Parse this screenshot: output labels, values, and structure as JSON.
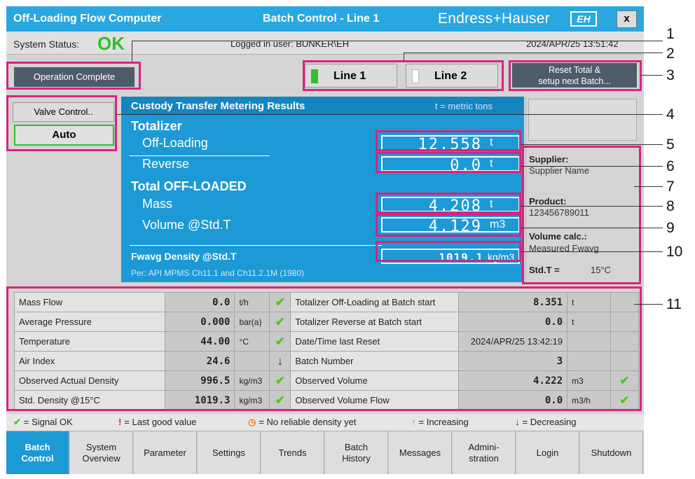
{
  "titlebar": {
    "app": "Off-Loading Flow Computer",
    "screen": "Batch Control - Line 1",
    "brand": "Endress+Hauser",
    "logo": "EH",
    "close": "x"
  },
  "status": {
    "label": "System Status:",
    "value": "OK",
    "user": "Logged in user: BUNKER\\EH",
    "datetime": "2024/APR/25  13:51:42"
  },
  "controls": {
    "operation": "Operation Complete",
    "line1": "Line 1",
    "line2": "Line 2",
    "reset_line1": "Reset Total &",
    "reset_line2": "setup next Batch...",
    "valve": "Valve Control..",
    "auto": "Auto"
  },
  "results": {
    "header": "Custody Transfer Metering Results",
    "unit_note": "t = metric tons",
    "totalizer": "Totalizer",
    "offloading": "Off-Loading",
    "offloading_val": "12.558",
    "offloading_unit": "t",
    "reverse": "Reverse",
    "reverse_val": "0.0",
    "reverse_unit": "t",
    "total": "Total OFF-LOADED",
    "mass": "Mass",
    "mass_val": "4.208",
    "mass_unit": "t",
    "volume": "Volume @Std.T",
    "volume_val": "4.129",
    "volume_unit": "m3",
    "density": "Fwavg Density @Std.T",
    "density_val": "1019.1",
    "density_unit": "kg/m3",
    "per": "Per: API MPMS Ch11.1 and Ch11.2.1M (1980)"
  },
  "side": {
    "supplier_k": "Supplier:",
    "supplier_v": "Supplier Name",
    "product_k": "Product:",
    "product_v": "123456789011",
    "volcalc_k": "Volume calc.:",
    "volcalc_v": "Measured Fwavg",
    "stdt_k": "Std.T =",
    "stdt_v": "15°C"
  },
  "grid": [
    {
      "label": "Mass Flow",
      "value": "0.0",
      "unit": "t/h",
      "icon": "check",
      "label2": "Totalizer Off-Loading at Batch start",
      "value2": "8.351",
      "unit2": "t",
      "icon2": ""
    },
    {
      "label": "Average Pressure",
      "value": "0.000",
      "unit": "bar(a)",
      "icon": "check",
      "label2": "Totalizer Reverse at Batch start",
      "value2": "0.0",
      "unit2": "t",
      "icon2": ""
    },
    {
      "label": "Temperature",
      "value": "44.00",
      "unit": "°C",
      "icon": "check",
      "label2": "Date/Time last Reset",
      "value2": "2024/APR/25 13:42:19",
      "unit2": "",
      "icon2": ""
    },
    {
      "label": "Air Index",
      "value": "24.6",
      "unit": "",
      "icon": "decreasing",
      "label2": "Batch Number",
      "value2": "3",
      "unit2": "",
      "icon2": ""
    },
    {
      "label": "Observed Actual Density",
      "value": "996.5",
      "unit": "kg/m3",
      "icon": "check",
      "label2": "Observed Volume",
      "value2": "4.222",
      "unit2": "m3",
      "icon2": "check"
    },
    {
      "label": "Std. Density @15°C",
      "value": "1019.3",
      "unit": "kg/m3",
      "icon": "check",
      "label2": "Observed Volume Flow",
      "value2": "0.0",
      "unit2": "m3/h",
      "icon2": "check"
    }
  ],
  "legend": {
    "ok": "= Signal OK",
    "last": "= Last good value",
    "nodens": "= No reliable density yet",
    "inc": "= Increasing",
    "dec": "= Decreasing"
  },
  "nav": [
    {
      "l1": "Batch",
      "l2": "Control"
    },
    {
      "l1": "System",
      "l2": "Overview"
    },
    {
      "l1": "Parameter",
      "l2": ""
    },
    {
      "l1": "Settings",
      "l2": ""
    },
    {
      "l1": "Trends",
      "l2": ""
    },
    {
      "l1": "Batch",
      "l2": "History"
    },
    {
      "l1": "Messages",
      "l2": ""
    },
    {
      "l1": "Admini-",
      "l2": "stration"
    },
    {
      "l1": "Login",
      "l2": ""
    },
    {
      "l1": "Shutdown",
      "l2": ""
    }
  ],
  "callouts": [
    "1",
    "2",
    "3",
    "4",
    "5",
    "6",
    "7",
    "8",
    "9",
    "10",
    "11"
  ],
  "colors": {
    "accent": "#1d99d6",
    "titlebar": "#29a7e0",
    "ok": "#2ec02e",
    "highlight": "#d4257f"
  }
}
